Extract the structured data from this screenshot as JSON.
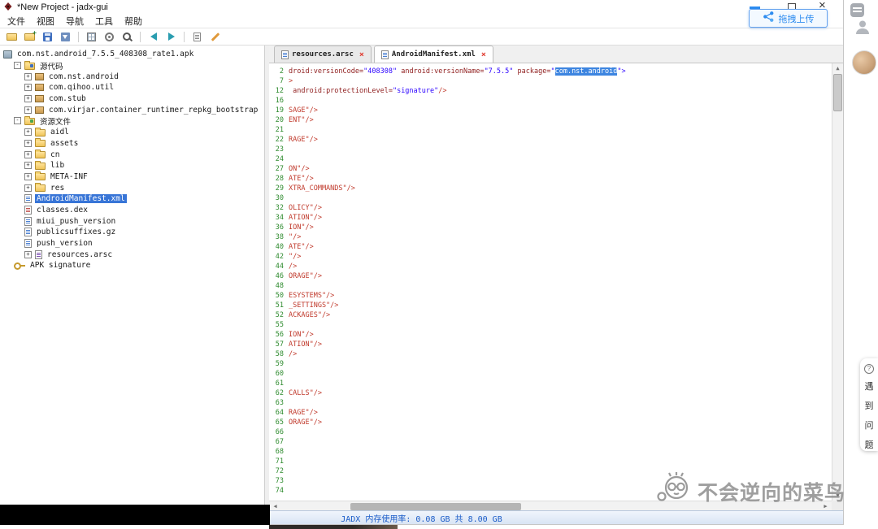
{
  "window": {
    "title": "*New Project - jadx-gui"
  },
  "ui": {
    "close_glyph": "×",
    "tab_close": "×",
    "scroll": {
      "up": "▲",
      "down": "▼",
      "left": "◀",
      "right": "▶"
    }
  },
  "menu": [
    "文件",
    "视图",
    "导航",
    "工具",
    "帮助"
  ],
  "toolbar": [
    "open-file",
    "add-files",
    "save-all",
    "export",
    "sep",
    "class-search",
    "preferences",
    "text-search",
    "sep",
    "nav-back",
    "nav-forward",
    "sep",
    "log-viewer",
    "deobfuscation"
  ],
  "tree": [
    {
      "label": "com.nst.android_7.5.5_408308_rate1.apk",
      "depth": 0,
      "icon": "apk",
      "exp": "",
      "selected": false
    },
    {
      "label": "源代码",
      "depth": 1,
      "icon": "folder-src",
      "exp": "-",
      "selected": false
    },
    {
      "label": "com.nst.android",
      "depth": 2,
      "icon": "pkg",
      "exp": "+",
      "selected": false
    },
    {
      "label": "com.qihoo.util",
      "depth": 2,
      "icon": "pkg",
      "exp": "+",
      "selected": false
    },
    {
      "label": "com.stub",
      "depth": 2,
      "icon": "pkg",
      "exp": "+",
      "selected": false
    },
    {
      "label": "com.virjar.container_runtimer_repkg_bootstrap",
      "depth": 2,
      "icon": "pkg",
      "exp": "+",
      "selected": false
    },
    {
      "label": "资源文件",
      "depth": 1,
      "icon": "folder-res",
      "exp": "-",
      "selected": false
    },
    {
      "label": "aidl",
      "depth": 2,
      "icon": "folder",
      "exp": "+",
      "selected": false
    },
    {
      "label": "assets",
      "depth": 2,
      "icon": "folder",
      "exp": "+",
      "selected": false
    },
    {
      "label": "cn",
      "depth": 2,
      "icon": "folder",
      "exp": "+",
      "selected": false
    },
    {
      "label": "lib",
      "depth": 2,
      "icon": "folder",
      "exp": "+",
      "selected": false
    },
    {
      "label": "META-INF",
      "depth": 2,
      "icon": "folder",
      "exp": "+",
      "selected": false
    },
    {
      "label": "res",
      "depth": 2,
      "icon": "folder",
      "exp": "+",
      "selected": false
    },
    {
      "label": "AndroidManifest.xml",
      "depth": 2,
      "icon": "doc",
      "exp": "",
      "selected": true
    },
    {
      "label": "classes.dex",
      "depth": 2,
      "icon": "doc-dex",
      "exp": "",
      "selected": false
    },
    {
      "label": "miui_push_version",
      "depth": 2,
      "icon": "doc",
      "exp": "",
      "selected": false
    },
    {
      "label": "publicsuffixes.gz",
      "depth": 2,
      "icon": "doc",
      "exp": "",
      "selected": false
    },
    {
      "label": "push_version",
      "depth": 2,
      "icon": "doc",
      "exp": "",
      "selected": false
    },
    {
      "label": "resources.arsc",
      "depth": 2,
      "icon": "doc-arsc",
      "exp": "+",
      "selected": false
    },
    {
      "label": "APK signature",
      "depth": 1,
      "icon": "key",
      "exp": "",
      "selected": false
    }
  ],
  "tabs": [
    {
      "label": "resources.arsc",
      "active": false
    },
    {
      "label": "AndroidManifest.xml",
      "active": true
    }
  ],
  "editor": {
    "lines": [
      {
        "num": 2,
        "segs": [
          {
            "t": "droid:versionCode=",
            "c": "attr"
          },
          {
            "t": "\"408308\"",
            "c": "val"
          },
          {
            "t": " ",
            "c": "p"
          },
          {
            "t": "android:versionName=",
            "c": "attr"
          },
          {
            "t": "\"7.5.5\"",
            "c": "val"
          },
          {
            "t": " ",
            "c": "p"
          },
          {
            "t": "package=",
            "c": "attr"
          },
          {
            "t": "\"",
            "c": "val"
          },
          {
            "t": "com.nst.android",
            "c": "sel"
          },
          {
            "t": "\">",
            "c": "val"
          }
        ]
      },
      {
        "num": 7,
        "segs": [
          {
            "t": ">",
            "c": "frag"
          }
        ]
      },
      {
        "num": 12,
        "segs": [
          {
            "t": " ",
            "c": "p"
          },
          {
            "t": "android:protectionLevel=",
            "c": "attr"
          },
          {
            "t": "\"signature\"",
            "c": "val"
          },
          {
            "t": "/>",
            "c": "frag"
          }
        ]
      },
      {
        "num": 16,
        "segs": []
      },
      {
        "num": 19,
        "segs": [
          {
            "t": "SAGE\"/>",
            "c": "frag"
          }
        ]
      },
      {
        "num": 20,
        "segs": [
          {
            "t": "ENT\"/>",
            "c": "frag"
          }
        ]
      },
      {
        "num": 21,
        "segs": []
      },
      {
        "num": 22,
        "segs": [
          {
            "t": "RAGE\"/>",
            "c": "frag"
          }
        ]
      },
      {
        "num": 23,
        "segs": []
      },
      {
        "num": 24,
        "segs": []
      },
      {
        "num": 27,
        "segs": [
          {
            "t": "ON\"/>",
            "c": "frag"
          }
        ]
      },
      {
        "num": 28,
        "segs": [
          {
            "t": "ATE\"/>",
            "c": "frag"
          }
        ]
      },
      {
        "num": 29,
        "segs": [
          {
            "t": "XTRA_COMMANDS\"/>",
            "c": "frag"
          }
        ]
      },
      {
        "num": 30,
        "segs": []
      },
      {
        "num": 32,
        "segs": [
          {
            "t": "OLICY\"/>",
            "c": "frag"
          }
        ]
      },
      {
        "num": 34,
        "segs": [
          {
            "t": "ATION\"/>",
            "c": "frag"
          }
        ]
      },
      {
        "num": 36,
        "segs": [
          {
            "t": "ION\"/>",
            "c": "frag"
          }
        ]
      },
      {
        "num": 38,
        "segs": [
          {
            "t": "\"/>",
            "c": "frag"
          }
        ]
      },
      {
        "num": 40,
        "segs": [
          {
            "t": "ATE\"/>",
            "c": "frag"
          }
        ]
      },
      {
        "num": 42,
        "segs": [
          {
            "t": "\"/>",
            "c": "frag"
          }
        ]
      },
      {
        "num": 44,
        "segs": [
          {
            "t": "/>",
            "c": "frag"
          }
        ]
      },
      {
        "num": 46,
        "segs": [
          {
            "t": "ORAGE\"/>",
            "c": "frag"
          }
        ]
      },
      {
        "num": 48,
        "segs": []
      },
      {
        "num": 50,
        "segs": [
          {
            "t": "ESYSTEMS\"/>",
            "c": "frag"
          }
        ]
      },
      {
        "num": 51,
        "segs": [
          {
            "t": "_SETTINGS\"/>",
            "c": "frag"
          }
        ]
      },
      {
        "num": 52,
        "segs": [
          {
            "t": "ACKAGES\"/>",
            "c": "frag"
          }
        ]
      },
      {
        "num": 55,
        "segs": []
      },
      {
        "num": 56,
        "segs": [
          {
            "t": "ION\"/>",
            "c": "frag"
          }
        ]
      },
      {
        "num": 57,
        "segs": [
          {
            "t": "ATION\"/>",
            "c": "frag"
          }
        ]
      },
      {
        "num": 58,
        "segs": [
          {
            "t": "/>",
            "c": "frag"
          }
        ]
      },
      {
        "num": 59,
        "segs": []
      },
      {
        "num": 60,
        "segs": []
      },
      {
        "num": 61,
        "segs": []
      },
      {
        "num": 62,
        "segs": [
          {
            "t": "CALLS\"/>",
            "c": "frag"
          }
        ]
      },
      {
        "num": 63,
        "segs": []
      },
      {
        "num": 64,
        "segs": [
          {
            "t": "RAGE\"/>",
            "c": "frag"
          }
        ]
      },
      {
        "num": 65,
        "segs": [
          {
            "t": "ORAGE\"/>",
            "c": "frag"
          }
        ]
      },
      {
        "num": 66,
        "segs": []
      },
      {
        "num": 67,
        "segs": []
      },
      {
        "num": 68,
        "segs": []
      },
      {
        "num": 71,
        "segs": []
      },
      {
        "num": 72,
        "segs": []
      },
      {
        "num": 73,
        "segs": []
      },
      {
        "num": 74,
        "segs": []
      }
    ]
  },
  "statusbar": {
    "text": "JADX 内存使用率: 0.08 GB 共 8.00 GB"
  },
  "overlay": {
    "upload_label": "拖拽上传",
    "watermark_text": "不会逆向的菜鸟",
    "help_icon": "?",
    "help_chars": [
      "遇",
      "到",
      "问",
      "题"
    ]
  },
  "colors": {
    "selection_bg": "#3d85e0",
    "tree_selection_bg": "#3875d7",
    "accent_blue": "#2d8cf0",
    "status_text": "#1b5cc8",
    "line_number": "#2e8b2e",
    "attr_name": "#8f1d1d",
    "attr_value": "#2a00ff",
    "fragment_red": "#c0392b",
    "tab_close_red": "#e03c31"
  }
}
